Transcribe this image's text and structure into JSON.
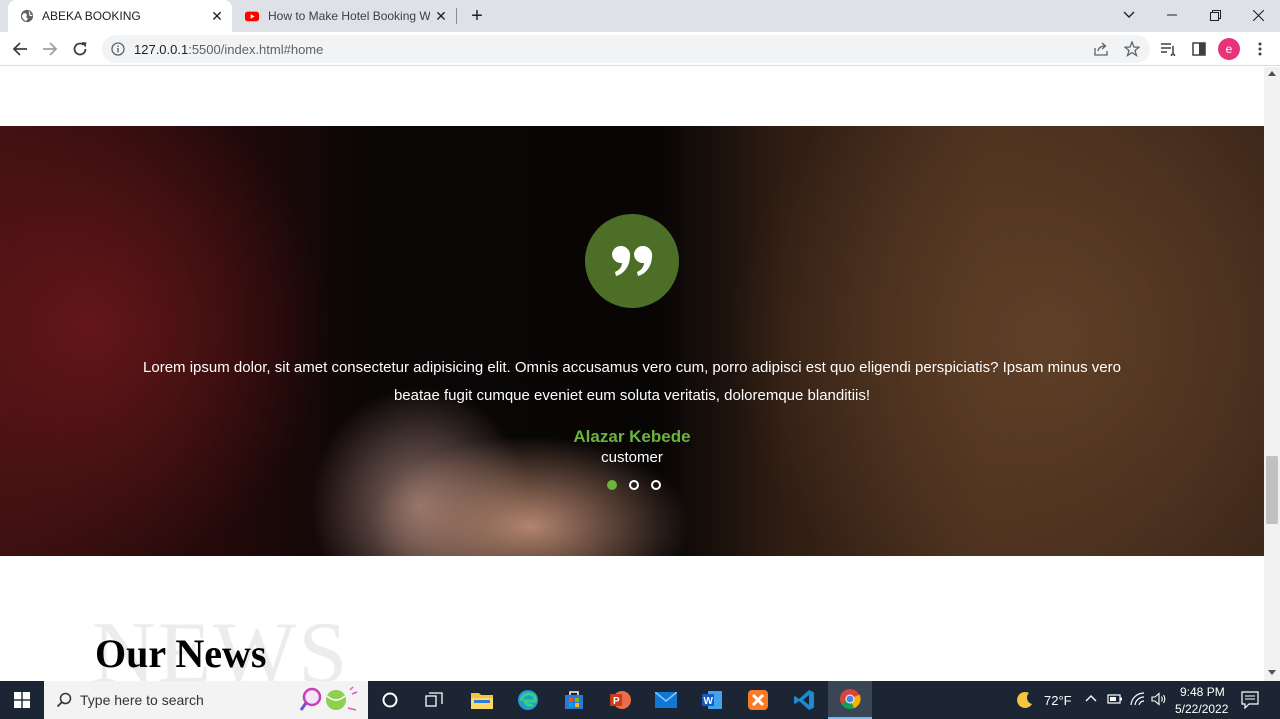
{
  "browser": {
    "tabs": [
      {
        "title": "ABEKA BOOKING",
        "active": true,
        "icon": "globe-icon"
      },
      {
        "title": "How to Make Hotel Booking Web",
        "active": false,
        "icon": "youtube-icon"
      }
    ],
    "url_host": "127.0.0.1",
    "url_rest": ":5500/index.html#home",
    "profile_initial": "e"
  },
  "testimonial": {
    "quote_icon": "quote-icon",
    "text": "Lorem ipsum dolor, sit amet consectetur adipisicing elit. Omnis accusamus vero cum, porro adipisci est quo eligendi perspiciatis? Ipsam minus vero beatae fugit cumque eveniet eum soluta veritatis, doloremque blanditiis!",
    "author": "Alazar Kebede",
    "role": "customer",
    "slides": 3,
    "active_slide": 1
  },
  "news": {
    "background_word": "NEWS",
    "title": "Our News"
  },
  "taskbar": {
    "search_placeholder": "Type here to search",
    "weather": "72°F",
    "time": "9:48 PM",
    "date": "5/22/2022"
  },
  "colors": {
    "accent_green": "#6ab43a",
    "quote_circle": "#4d6e26"
  }
}
